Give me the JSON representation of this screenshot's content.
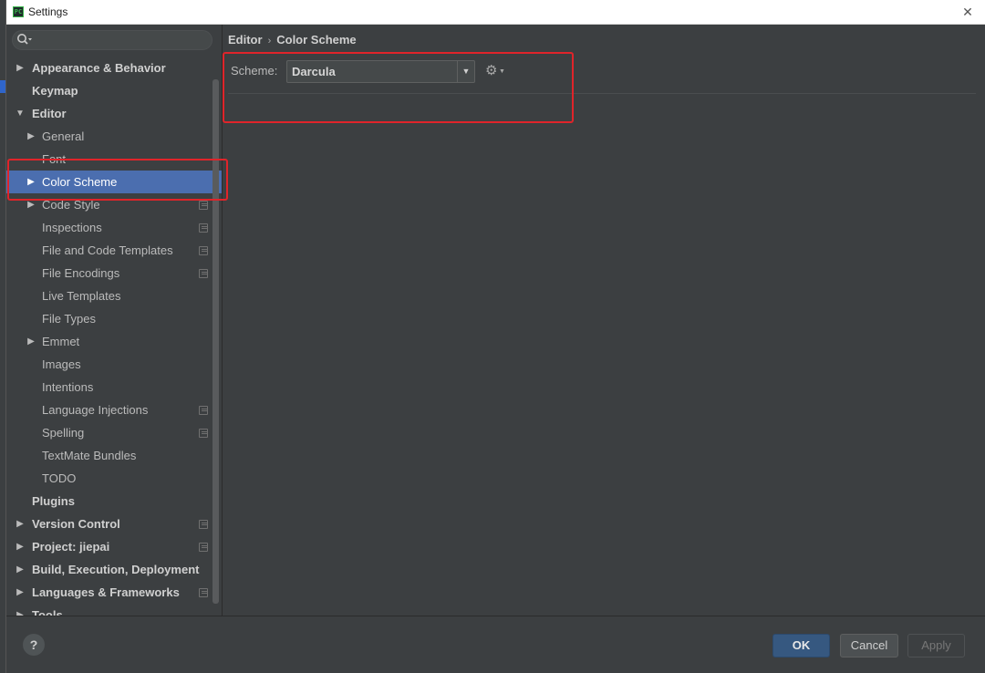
{
  "window": {
    "title": "Settings",
    "app_icon_text": "PC"
  },
  "search": {
    "placeholder": ""
  },
  "sidebar": {
    "items": [
      {
        "label": "Appearance & Behavior",
        "level": 0,
        "arrow": "▶",
        "bold": true
      },
      {
        "label": "Keymap",
        "level": 0,
        "arrow": "",
        "bold": true
      },
      {
        "label": "Editor",
        "level": 0,
        "arrow": "▼",
        "bold": true
      },
      {
        "label": "General",
        "level": 1,
        "arrow": "▶"
      },
      {
        "label": "Font",
        "level": 1,
        "arrow": ""
      },
      {
        "label": "Color Scheme",
        "level": 1,
        "arrow": "▶",
        "selected": true
      },
      {
        "label": "Code Style",
        "level": 1,
        "arrow": "▶",
        "project": true
      },
      {
        "label": "Inspections",
        "level": 1,
        "arrow": "",
        "project": true
      },
      {
        "label": "File and Code Templates",
        "level": 1,
        "arrow": "",
        "project": true
      },
      {
        "label": "File Encodings",
        "level": 1,
        "arrow": "",
        "project": true
      },
      {
        "label": "Live Templates",
        "level": 1,
        "arrow": ""
      },
      {
        "label": "File Types",
        "level": 1,
        "arrow": ""
      },
      {
        "label": "Emmet",
        "level": 1,
        "arrow": "▶"
      },
      {
        "label": "Images",
        "level": 1,
        "arrow": ""
      },
      {
        "label": "Intentions",
        "level": 1,
        "arrow": ""
      },
      {
        "label": "Language Injections",
        "level": 1,
        "arrow": "",
        "project": true
      },
      {
        "label": "Spelling",
        "level": 1,
        "arrow": "",
        "project": true
      },
      {
        "label": "TextMate Bundles",
        "level": 1,
        "arrow": ""
      },
      {
        "label": "TODO",
        "level": 1,
        "arrow": ""
      },
      {
        "label": "Plugins",
        "level": 0,
        "arrow": "",
        "bold": true
      },
      {
        "label": "Version Control",
        "level": 0,
        "arrow": "▶",
        "bold": true,
        "project": true
      },
      {
        "label": "Project: jiepai",
        "level": 0,
        "arrow": "▶",
        "bold": true,
        "project": true
      },
      {
        "label": "Build, Execution, Deployment",
        "level": 0,
        "arrow": "▶",
        "bold": true
      },
      {
        "label": "Languages & Frameworks",
        "level": 0,
        "arrow": "▶",
        "bold": true,
        "project": true
      },
      {
        "label": "Tools",
        "level": 0,
        "arrow": "▶",
        "bold": true
      }
    ]
  },
  "breadcrumb": {
    "parent": "Editor",
    "separator": "›",
    "current": "Color Scheme"
  },
  "scheme": {
    "label": "Scheme:",
    "value": "Darcula"
  },
  "footer": {
    "help": "?",
    "ok": "OK",
    "cancel": "Cancel",
    "apply": "Apply"
  },
  "colors": {
    "selection": "#4b6eaf",
    "highlight_box": "#e0242a",
    "ok_button": "#365880",
    "background": "#3c3f41"
  }
}
